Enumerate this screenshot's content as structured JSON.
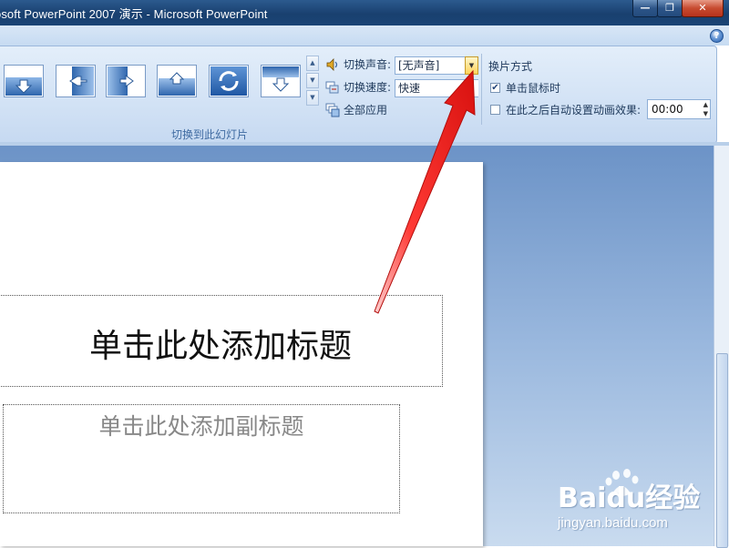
{
  "window": {
    "title": "osoft PowerPoint 2007 演示 - Microsoft PowerPoint",
    "minimize": "—",
    "restore": "❐",
    "close": "✕"
  },
  "ribbon": {
    "help": "?",
    "group_label": "切换到此幻灯片",
    "sound_label": "切换声音:",
    "sound_value": "[无声音]",
    "speed_label": "切换速度:",
    "speed_value": "快速",
    "apply_all_label": "全部应用",
    "advance_title": "换片方式",
    "on_click_label": "单击鼠标时",
    "on_click_checked": true,
    "auto_after_label": "在此之后自动设置动画效果:",
    "auto_after_checked": false,
    "auto_after_value": "00:00"
  },
  "slide": {
    "title_placeholder": "单击此处添加标题",
    "subtitle_placeholder": "单击此处添加副标题"
  },
  "watermark": {
    "brand": "Baidu经验",
    "url": "jingyan.baidu.com"
  },
  "colors": {
    "annotation_arrow": "#e8201e",
    "accent": "#1e395b"
  }
}
